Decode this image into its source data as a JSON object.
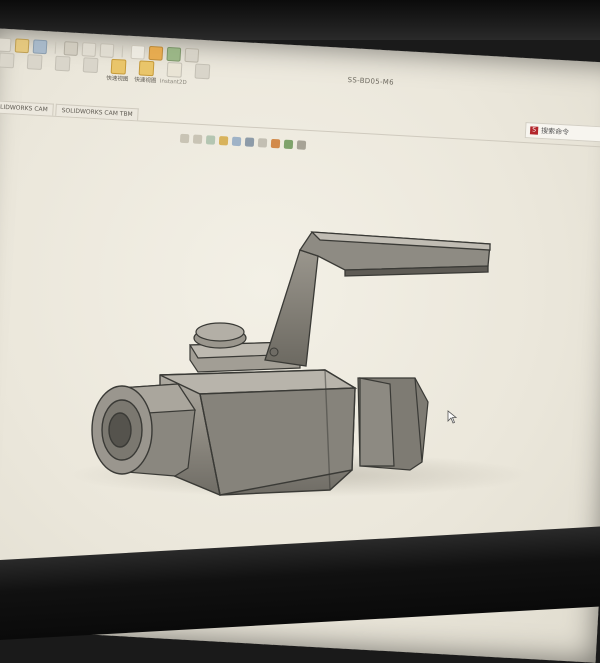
{
  "window": {
    "document_title": "SS-BD05-M6"
  },
  "search": {
    "label": "搜索命令"
  },
  "ribbon": {
    "commands": [
      {
        "label": "",
        "icon": "gear-icon"
      },
      {
        "label": "",
        "icon": "sketch-icon"
      },
      {
        "label": "",
        "icon": "feature-icon"
      },
      {
        "label": "",
        "icon": "view-icon"
      },
      {
        "label": "快速视图",
        "icon": "quick-view-icon"
      },
      {
        "label": "快速视图",
        "icon": "quick-view-2-icon"
      },
      {
        "label": "Instant2D",
        "icon": "instant2d-icon"
      },
      {
        "label": "",
        "icon": "markup-icon"
      }
    ]
  },
  "tabs": [
    {
      "label": "SOLIDWORKS CAM"
    },
    {
      "label": "SOLIDWORKS CAM TBM"
    }
  ],
  "colors": {
    "screen_bg": "#f0ede3",
    "model_body": "#8a8780",
    "model_edge": "#3a3a36",
    "accent_yellow": "#e9c56a"
  }
}
